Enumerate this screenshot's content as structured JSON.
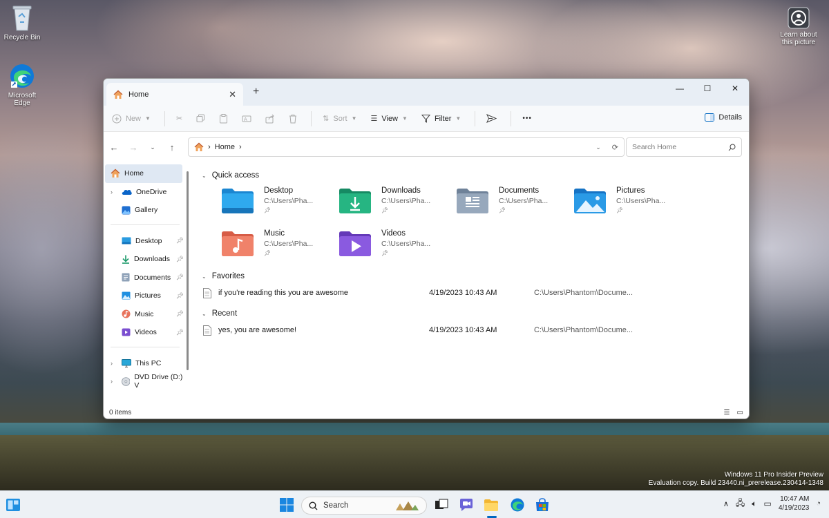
{
  "desktop": {
    "recycle_bin": "Recycle Bin",
    "edge_line1": "Microsoft",
    "edge_line2": "Edge",
    "learn_line1": "Learn about",
    "learn_line2": "this picture",
    "watermark_line1": "Windows 11 Pro Insider Preview",
    "watermark_line2": "Evaluation copy. Build 23440.ni_prerelease.230414-1348"
  },
  "window": {
    "tab_title": "Home",
    "new_tab": "+",
    "toolbar": {
      "new_label": "New",
      "sort_label": "Sort",
      "view_label": "View",
      "filter_label": "Filter",
      "more_label": "•••",
      "details_label": "Details"
    },
    "address": {
      "crumb": "Home",
      "search_placeholder": "Search Home"
    },
    "sidebar": {
      "home": "Home",
      "onedrive": "OneDrive",
      "gallery": "Gallery",
      "desktop": "Desktop",
      "downloads": "Downloads",
      "documents": "Documents",
      "pictures": "Pictures",
      "music": "Music",
      "videos": "Videos",
      "this_pc": "This PC",
      "dvd": "DVD Drive (D:) V"
    },
    "quick_access": {
      "heading": "Quick access",
      "items": [
        {
          "name": "Desktop",
          "path": "C:\\Users\\Pha..."
        },
        {
          "name": "Downloads",
          "path": "C:\\Users\\Pha..."
        },
        {
          "name": "Documents",
          "path": "C:\\Users\\Pha..."
        },
        {
          "name": "Pictures",
          "path": "C:\\Users\\Pha..."
        },
        {
          "name": "Music",
          "path": "C:\\Users\\Pha..."
        },
        {
          "name": "Videos",
          "path": "C:\\Users\\Pha..."
        }
      ]
    },
    "favorites": {
      "heading": "Favorites",
      "rows": [
        {
          "name": "if you're reading this you are awesome",
          "date": "4/19/2023 10:43 AM",
          "path": "C:\\Users\\Phantom\\Docume..."
        }
      ]
    },
    "recent": {
      "heading": "Recent",
      "rows": [
        {
          "name": "yes, you are awesome!",
          "date": "4/19/2023 10:43 AM",
          "path": "C:\\Users\\Phantom\\Docume..."
        }
      ]
    },
    "status": "0 items"
  },
  "taskbar": {
    "search_label": "Search",
    "time": "10:47 AM",
    "date": "4/19/2023"
  },
  "colors": {
    "accent": "#0067c0",
    "folder_blue": "#2a8fd9",
    "folder_green": "#23a27a",
    "folder_gray": "#8a9bb0",
    "folder_orange": "#e8725b",
    "folder_purple": "#7b4fd0"
  }
}
